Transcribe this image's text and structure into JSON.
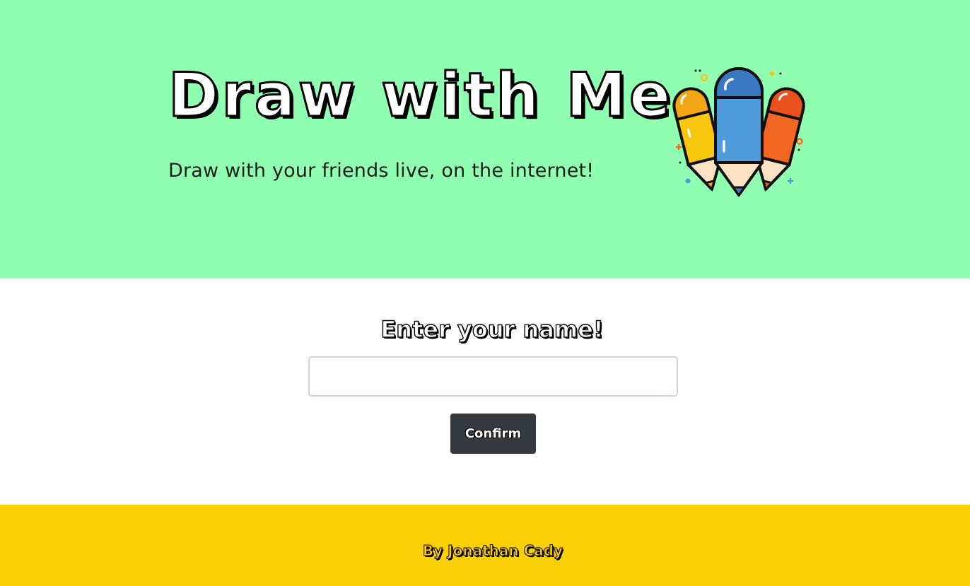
{
  "hero": {
    "title": "Draw with Me",
    "subtitle": "Draw with your friends live, on the internet!",
    "illustration": "colored-pencils-illustration",
    "background_color": "#91ffb1"
  },
  "form": {
    "heading": "Enter your name!",
    "name_input": {
      "value": "",
      "placeholder": ""
    },
    "confirm_label": "Confirm",
    "button_color": "#343a40"
  },
  "footer": {
    "credit": "By Jonathan Cady",
    "background_color": "#fbd009"
  }
}
